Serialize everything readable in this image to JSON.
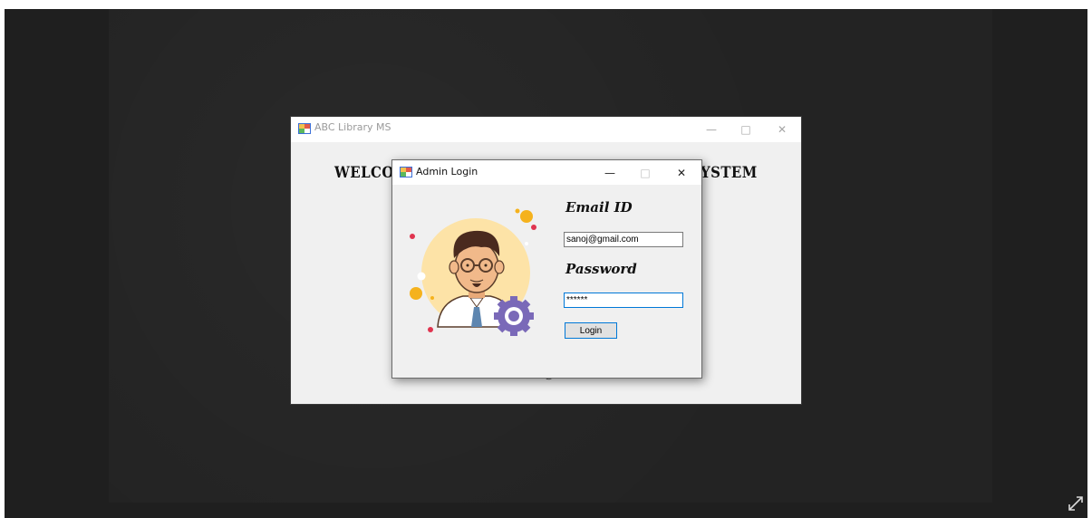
{
  "main_window": {
    "title": "ABC Library MS",
    "welcome_left": "WELCO",
    "welcome_right": "YSTEM",
    "footer_fragment": "... ..........@.... ......"
  },
  "dialog": {
    "title": "Admin Login",
    "email_label": "Email ID",
    "email_value": "sanoj@gmail.com",
    "password_label": "Password",
    "password_value": "******",
    "login_label": "Login"
  },
  "icons": {
    "app": "app-window-icon",
    "minimize": "minimize-icon",
    "maximize": "maximize-icon",
    "close": "close-icon",
    "expand": "expand-icon",
    "avatar": "admin-avatar-illustration"
  },
  "colors": {
    "backdrop": "#1f1f1f",
    "window_bg": "#f0f0f0",
    "titlebar_bg": "#ffffff",
    "focus_border": "#0078d7"
  }
}
